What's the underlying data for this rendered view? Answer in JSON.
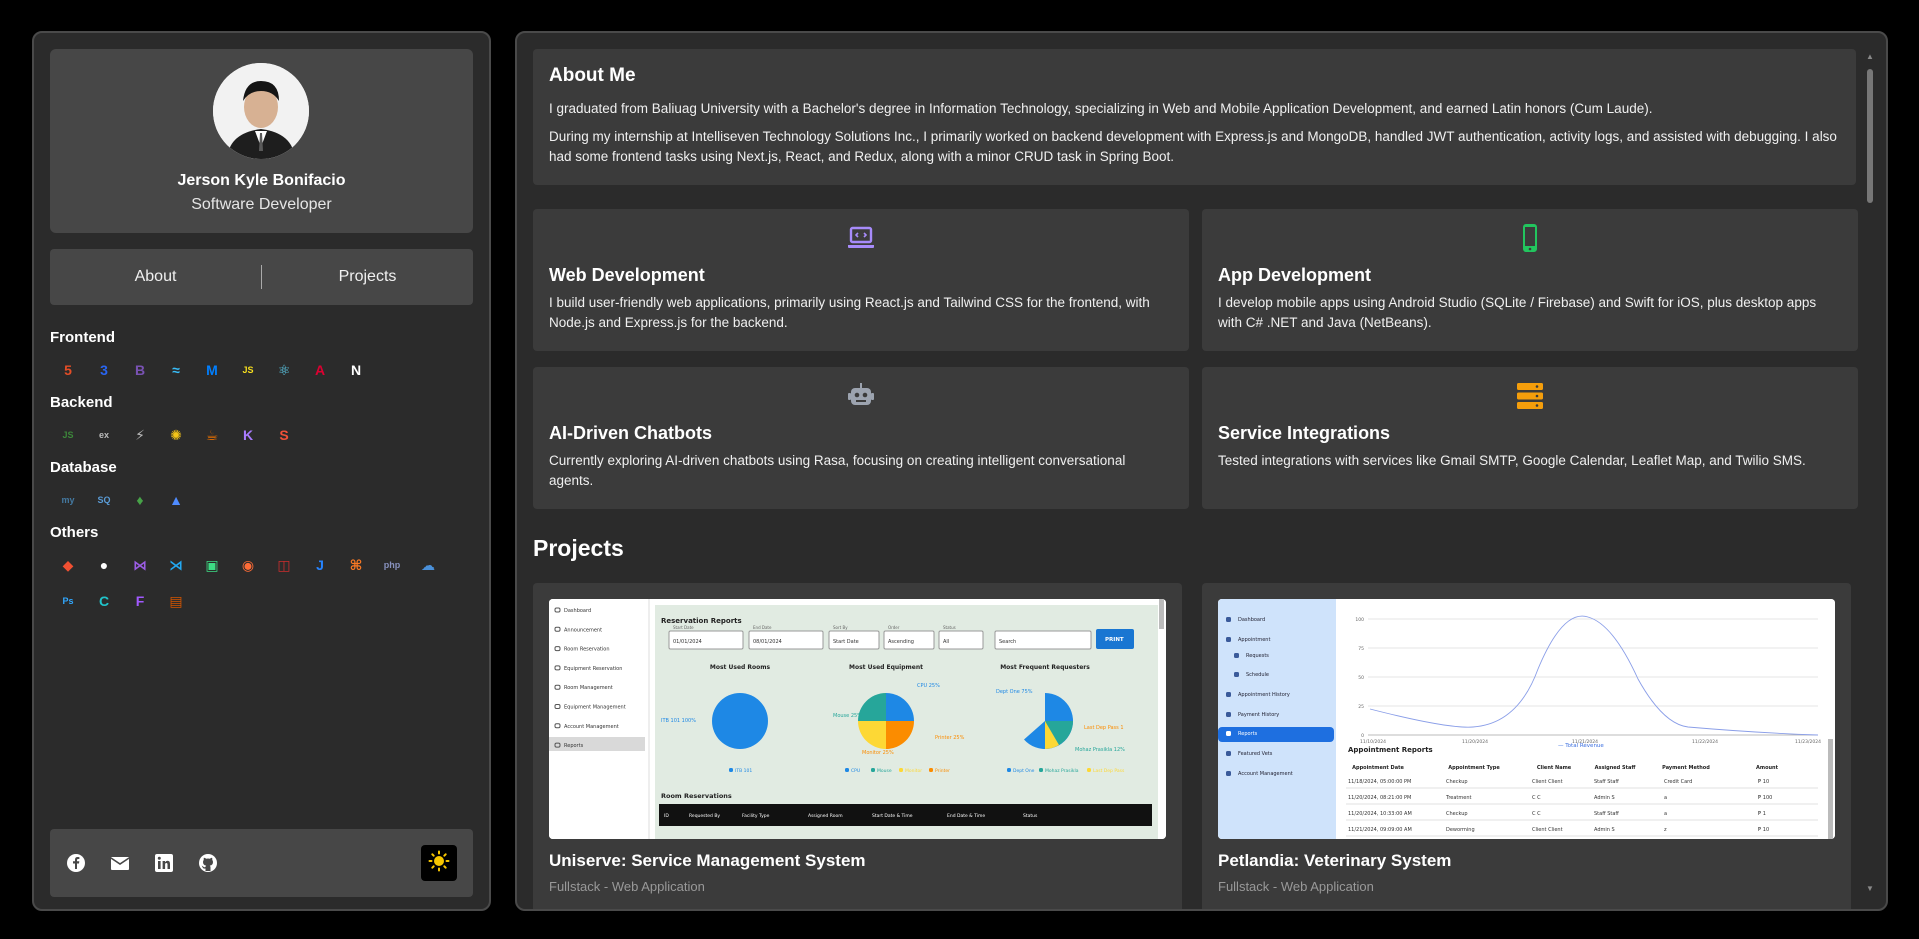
{
  "profile": {
    "name": "Jerson Kyle Bonifacio",
    "role": "Software Developer"
  },
  "nav": {
    "about": "About",
    "projects": "Projects"
  },
  "skills": [
    {
      "title": "Frontend",
      "icons": [
        {
          "name": "html5-icon",
          "glyph": "5",
          "color": "#e44d26"
        },
        {
          "name": "css3-icon",
          "glyph": "3",
          "color": "#2965f1"
        },
        {
          "name": "bootstrap-icon",
          "glyph": "B",
          "color": "#7952b3"
        },
        {
          "name": "tailwind-icon",
          "glyph": "≈",
          "color": "#38bdf8"
        },
        {
          "name": "mui-icon",
          "glyph": "M",
          "color": "#007fff"
        },
        {
          "name": "javascript-icon",
          "glyph": "JS",
          "color": "#f7df1e"
        },
        {
          "name": "react-icon",
          "glyph": "⚛",
          "color": "#61dafb"
        },
        {
          "name": "angular-icon",
          "glyph": "A",
          "color": "#dd0031"
        },
        {
          "name": "nextjs-icon",
          "glyph": "N",
          "color": "#ffffff"
        }
      ]
    },
    {
      "title": "Backend",
      "icons": [
        {
          "name": "nodejs-icon",
          "glyph": "JS",
          "color": "#3c873a"
        },
        {
          "name": "express-icon",
          "glyph": "ex",
          "color": "#bbbbbb"
        },
        {
          "name": "django-icon",
          "glyph": "⚡",
          "color": "#bbbbbb"
        },
        {
          "name": "spring-icon",
          "glyph": "✺",
          "color": "#f5c518"
        },
        {
          "name": "java-icon",
          "glyph": "☕",
          "color": "#e76f00"
        },
        {
          "name": "kotlin-icon",
          "glyph": "K",
          "color": "#a97bff"
        },
        {
          "name": "swift-icon",
          "glyph": "S",
          "color": "#f05138"
        }
      ]
    },
    {
      "title": "Database",
      "icons": [
        {
          "name": "mysql-icon",
          "glyph": "my",
          "color": "#4479a1"
        },
        {
          "name": "sqlserver-icon",
          "glyph": "SQ",
          "color": "#5a9bd5"
        },
        {
          "name": "mongodb-icon",
          "glyph": "♦",
          "color": "#47a248"
        },
        {
          "name": "firebase-icon",
          "glyph": "▲",
          "color": "#4f8cff"
        }
      ]
    },
    {
      "title": "Others",
      "icons": [
        {
          "name": "git-icon",
          "glyph": "◆",
          "color": "#f05032"
        },
        {
          "name": "github-icon",
          "glyph": "●",
          "color": "#ffffff"
        },
        {
          "name": "visual-studio-icon",
          "glyph": "⋈",
          "color": "#9b5de5"
        },
        {
          "name": "vscode-icon",
          "glyph": "⋊",
          "color": "#23a9f2"
        },
        {
          "name": "android-icon",
          "glyph": "▣",
          "color": "#3ddc84"
        },
        {
          "name": "postman-icon",
          "glyph": "◉",
          "color": "#ff6c37"
        },
        {
          "name": "cube-icon",
          "glyph": "◫",
          "color": "#cc2d2d"
        },
        {
          "name": "jira-icon",
          "glyph": "J",
          "color": "#2684ff"
        },
        {
          "name": "xampp-icon",
          "glyph": "⌘",
          "color": "#fb7a24"
        },
        {
          "name": "php-icon",
          "glyph": "php",
          "color": "#8892bf"
        },
        {
          "name": "cloud-icon",
          "glyph": "☁",
          "color": "#4a90d9"
        },
        {
          "name": "photoshop-icon",
          "glyph": "Ps",
          "color": "#31a8ff"
        },
        {
          "name": "canva-icon",
          "glyph": "C",
          "color": "#20c4cb"
        },
        {
          "name": "figma-icon",
          "glyph": "F",
          "color": "#a259ff"
        },
        {
          "name": "package-icon",
          "glyph": "▤",
          "color": "#d35400"
        }
      ]
    }
  ],
  "about": {
    "title": "About Me",
    "p1": "I graduated from Baliuag University with a Bachelor's degree in Information Technology, specializing in Web and Mobile Application Development, and earned Latin honors (Cum Laude).",
    "p2": "During my internship at Intelliseven Technology Solutions Inc., I primarily worked on backend development with Express.js and MongoDB, handled JWT authentication, activity logs, and assisted with debugging. I also had some frontend tasks using Next.js, React, and Redux, along with a minor CRUD task in Spring Boot."
  },
  "services": [
    {
      "title": "Web Development",
      "desc": "I build user-friendly web applications, primarily using React.js and Tailwind CSS for the frontend, with Node.js and Express.js for the backend.",
      "icon_color": "#a78bfa"
    },
    {
      "title": "App Development",
      "desc": "I develop mobile apps using Android Studio (SQLite / Firebase) and Swift for iOS, plus desktop apps with C# .NET and Java (NetBeans).",
      "icon_color": "#22c55e"
    },
    {
      "title": "AI-Driven Chatbots",
      "desc": "Currently exploring AI-driven chatbots using Rasa, focusing on creating intelligent conversational agents.",
      "icon_color": "#9ca3af"
    },
    {
      "title": "Service Integrations",
      "desc": "Tested integrations with services like Gmail SMTP, Google Calendar, Leaflet Map, and Twilio SMS.",
      "icon_color": "#f59e0b"
    }
  ],
  "projects_title": "Projects",
  "projects": [
    {
      "name": "Uniserve: Service Management System",
      "type": "Fullstack - Web Application"
    },
    {
      "name": "Petlandia: Veterinary System",
      "type": "Fullstack - Web Application"
    }
  ],
  "shot1": {
    "sidebar": [
      "Dashboard",
      "Announcement",
      "Room Reservation",
      "Equipment Reservation",
      "Room Management",
      "Equipment Management",
      "Account Management",
      "Reports"
    ],
    "heading": "Reservation Reports",
    "filters": [
      "Start Date",
      "End Date",
      "Sort By",
      "Order",
      "Status"
    ],
    "filter_values": [
      "01/01/2024",
      "08/01/2024",
      "Start Date",
      "Ascending",
      "All",
      "Search"
    ],
    "print": "PRINT",
    "chart_titles": [
      "Most Used Rooms",
      "Most Used Equipment",
      "Most Frequent Requesters"
    ],
    "chart_labels": [
      "ITB 101 100%",
      "CPU 25%",
      "Mouse 25%",
      "Monitor 25%",
      "Printer 25%",
      "Dept One 75%",
      "Last Dep Pass 1",
      "Mohaz Prasikla 12%"
    ],
    "legends": [
      "ITB 101",
      "CPU",
      "Mouse",
      "Monitor",
      "Printer",
      "Dept One",
      "Mohaz Prasikla",
      "Last Dep Pass"
    ],
    "table_heading": "Room Reservations",
    "table_cols": [
      "ID",
      "Requested By",
      "Facility Type",
      "Assigned Room",
      "Start Date & Time",
      "End Date & Time",
      "Status"
    ]
  },
  "shot2": {
    "sidebar": [
      "Dashboard",
      "Appointment",
      "Requests",
      "Schedule",
      "Appointment History",
      "Payment History",
      "Reports",
      "Featured Vets",
      "Account Management"
    ],
    "y_ticks": [
      "100",
      "75",
      "50",
      "25",
      "0"
    ],
    "x_ticks": [
      "11/10/2024",
      "11/20/2024",
      "11/21/2024",
      "11/22/2024",
      "11/23/2024"
    ],
    "legend": "Total Revenue",
    "heading": "Appointment Reports",
    "cols": [
      "Appointment Date",
      "Appointment Type",
      "Client Name",
      "Assigned Staff",
      "Payment Method",
      "Amount"
    ],
    "rows": [
      [
        "11/18/2024, 05:00:00 PM",
        "Checkup",
        "Client Client",
        "Staff Staff",
        "Credit Card",
        "₱ 10"
      ],
      [
        "11/20/2024, 08:21:00 PM",
        "Treatment",
        "C C",
        "Admin S",
        "a",
        "₱ 100"
      ],
      [
        "11/20/2024, 10:33:00 AM",
        "Checkup",
        "C C",
        "Staff Staff",
        "a",
        "₱ 1"
      ],
      [
        "11/21/2024, 09:09:00 AM",
        "Deworming",
        "Client Client",
        "Admin S",
        "z",
        "₱ 10"
      ]
    ]
  }
}
